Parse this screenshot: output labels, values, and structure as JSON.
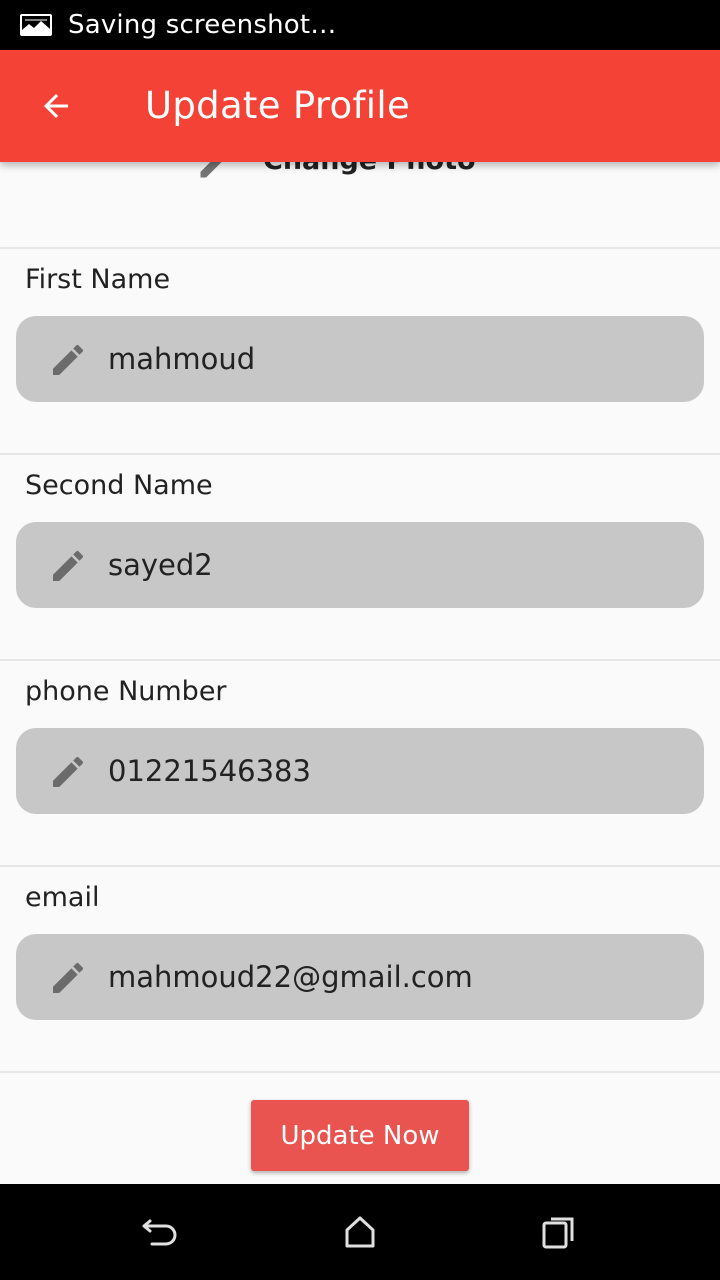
{
  "status_bar": {
    "text": "Saving screenshot…"
  },
  "app_bar": {
    "title": "Update Profile",
    "back_icon": "arrow-left-icon"
  },
  "photo": {
    "label": "Change Photo",
    "icon": "pencil-icon"
  },
  "fields": [
    {
      "label": "First Name",
      "value": "mahmoud"
    },
    {
      "label": "Second Name",
      "value": "sayed2"
    },
    {
      "label": "phone Number",
      "value": "01221546383"
    },
    {
      "label": "email",
      "value": "mahmoud22@gmail.com"
    }
  ],
  "actions": {
    "update_label": "Update Now"
  },
  "colors": {
    "app_bar": "#f44336",
    "button": "#ea5450",
    "field_bg": "#c7c7c7"
  },
  "nav_bar": {
    "back": "nav-back-icon",
    "home": "nav-home-icon",
    "recents": "nav-recents-icon"
  }
}
